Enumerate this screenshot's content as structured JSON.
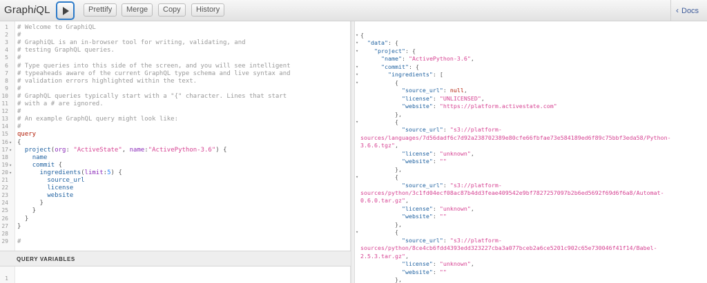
{
  "toolbar": {
    "title_prefix": "Graph",
    "title_em": "i",
    "title_suffix": "QL",
    "buttons": [
      "Prettify",
      "Merge",
      "Copy",
      "History"
    ],
    "docs_label": "Docs"
  },
  "editor": {
    "lines": [
      {
        "n": "1",
        "fold": "",
        "parts": [
          [
            "c-comment",
            "# Welcome to GraphiQL"
          ]
        ]
      },
      {
        "n": "2",
        "fold": "",
        "parts": [
          [
            "c-comment",
            "#"
          ]
        ]
      },
      {
        "n": "3",
        "fold": "",
        "parts": [
          [
            "c-comment",
            "# GraphiQL is an in-browser tool for writing, validating, and"
          ]
        ]
      },
      {
        "n": "4",
        "fold": "",
        "parts": [
          [
            "c-comment",
            "# testing GraphQL queries."
          ]
        ]
      },
      {
        "n": "5",
        "fold": "",
        "parts": [
          [
            "c-comment",
            "#"
          ]
        ]
      },
      {
        "n": "6",
        "fold": "",
        "parts": [
          [
            "c-comment",
            "# Type queries into this side of the screen, and you will see intelligent"
          ]
        ]
      },
      {
        "n": "7",
        "fold": "",
        "parts": [
          [
            "c-comment",
            "# typeaheads aware of the current GraphQL type schema and live syntax and"
          ]
        ]
      },
      {
        "n": "8",
        "fold": "",
        "parts": [
          [
            "c-comment",
            "# validation errors highlighted within the text."
          ]
        ]
      },
      {
        "n": "9",
        "fold": "",
        "parts": [
          [
            "c-comment",
            "#"
          ]
        ]
      },
      {
        "n": "10",
        "fold": "",
        "parts": [
          [
            "c-comment",
            "# GraphQL queries typically start with a \"{\" character. Lines that start"
          ]
        ]
      },
      {
        "n": "11",
        "fold": "",
        "parts": [
          [
            "c-comment",
            "# with a # are ignored."
          ]
        ]
      },
      {
        "n": "12",
        "fold": "",
        "parts": [
          [
            "c-comment",
            "#"
          ]
        ]
      },
      {
        "n": "13",
        "fold": "",
        "parts": [
          [
            "c-comment",
            "# An example GraphQL query might look like:"
          ]
        ]
      },
      {
        "n": "14",
        "fold": "",
        "parts": [
          [
            "c-comment",
            "#"
          ]
        ]
      },
      {
        "n": "15",
        "fold": "",
        "parts": [
          [
            "c-kw",
            "query"
          ]
        ]
      },
      {
        "n": "16",
        "fold": "▾",
        "parts": [
          [
            "c-punct",
            "{"
          ]
        ]
      },
      {
        "n": "17",
        "fold": "▾",
        "parts": [
          [
            "c-punct",
            "  "
          ],
          [
            "c-prop",
            "project"
          ],
          [
            "c-punct",
            "("
          ],
          [
            "c-attr",
            "org"
          ],
          [
            "c-punct",
            ": "
          ],
          [
            "c-str",
            "\"ActiveState\""
          ],
          [
            "c-punct",
            ", "
          ],
          [
            "c-attr",
            "name"
          ],
          [
            "c-punct",
            ":"
          ],
          [
            "c-str",
            "\"ActivePython-3.6\""
          ],
          [
            "c-punct",
            ") {"
          ]
        ]
      },
      {
        "n": "18",
        "fold": "",
        "parts": [
          [
            "c-punct",
            "    "
          ],
          [
            "c-prop",
            "name"
          ]
        ]
      },
      {
        "n": "19",
        "fold": "▾",
        "parts": [
          [
            "c-punct",
            "    "
          ],
          [
            "c-prop",
            "commit"
          ],
          [
            "c-punct",
            " {"
          ]
        ]
      },
      {
        "n": "20",
        "fold": "▾",
        "parts": [
          [
            "c-punct",
            "      "
          ],
          [
            "c-prop",
            "ingredients"
          ],
          [
            "c-punct",
            "("
          ],
          [
            "c-attr",
            "limit"
          ],
          [
            "c-punct",
            ":"
          ],
          [
            "c-num",
            "5"
          ],
          [
            "c-punct",
            ") {"
          ]
        ]
      },
      {
        "n": "21",
        "fold": "",
        "parts": [
          [
            "c-punct",
            "        "
          ],
          [
            "c-prop",
            "source_url"
          ]
        ]
      },
      {
        "n": "22",
        "fold": "",
        "parts": [
          [
            "c-punct",
            "        "
          ],
          [
            "c-prop",
            "license"
          ]
        ]
      },
      {
        "n": "23",
        "fold": "",
        "parts": [
          [
            "c-punct",
            "        "
          ],
          [
            "c-prop",
            "website"
          ]
        ]
      },
      {
        "n": "24",
        "fold": "",
        "parts": [
          [
            "c-punct",
            "      }"
          ]
        ]
      },
      {
        "n": "25",
        "fold": "",
        "parts": [
          [
            "c-punct",
            "    }"
          ]
        ]
      },
      {
        "n": "26",
        "fold": "",
        "parts": [
          [
            "c-punct",
            "  }"
          ]
        ]
      },
      {
        "n": "27",
        "fold": "",
        "parts": [
          [
            "c-punct",
            "}"
          ]
        ]
      },
      {
        "n": "28",
        "fold": "",
        "parts": [
          [
            "c-punct",
            ""
          ]
        ]
      },
      {
        "n": "29",
        "fold": "",
        "parts": [
          [
            "c-comment",
            "#"
          ]
        ]
      }
    ]
  },
  "query_variables": {
    "title": "QUERY VARIABLES",
    "line_number": "1"
  },
  "result": {
    "lines": [
      {
        "fold": "▾",
        "parts": [
          [
            "p",
            "{"
          ]
        ]
      },
      {
        "fold": "▾",
        "parts": [
          [
            "p",
            "  "
          ],
          [
            "k",
            "\"data\""
          ],
          [
            "p",
            ": {"
          ]
        ]
      },
      {
        "fold": "▾",
        "parts": [
          [
            "p",
            "    "
          ],
          [
            "k",
            "\"project\""
          ],
          [
            "p",
            ": {"
          ]
        ]
      },
      {
        "fold": "",
        "parts": [
          [
            "p",
            "      "
          ],
          [
            "k",
            "\"name\""
          ],
          [
            "p",
            ": "
          ],
          [
            "s",
            "\"ActivePython-3.6\""
          ],
          [
            "p",
            ","
          ]
        ]
      },
      {
        "fold": "▾",
        "parts": [
          [
            "p",
            "      "
          ],
          [
            "k",
            "\"commit\""
          ],
          [
            "p",
            ": {"
          ]
        ]
      },
      {
        "fold": "▾",
        "parts": [
          [
            "p",
            "        "
          ],
          [
            "k",
            "\"ingredients\""
          ],
          [
            "p",
            ": ["
          ]
        ]
      },
      {
        "fold": "▾",
        "parts": [
          [
            "p",
            "          {"
          ]
        ]
      },
      {
        "fold": "",
        "parts": [
          [
            "p",
            "            "
          ],
          [
            "k",
            "\"source_url\""
          ],
          [
            "p",
            ": "
          ],
          [
            "n",
            "null"
          ],
          [
            "p",
            ","
          ]
        ]
      },
      {
        "fold": "",
        "parts": [
          [
            "p",
            "            "
          ],
          [
            "k",
            "\"license\""
          ],
          [
            "p",
            ": "
          ],
          [
            "s",
            "\"UNLICENSED\""
          ],
          [
            "p",
            ","
          ]
        ]
      },
      {
        "fold": "",
        "parts": [
          [
            "p",
            "            "
          ],
          [
            "k",
            "\"website\""
          ],
          [
            "p",
            ": "
          ],
          [
            "s",
            "\"https://platform.activestate.com\""
          ]
        ]
      },
      {
        "fold": "",
        "parts": [
          [
            "p",
            "          },"
          ]
        ]
      },
      {
        "fold": "▾",
        "parts": [
          [
            "p",
            "          {"
          ]
        ]
      },
      {
        "fold": "",
        "parts": [
          [
            "p",
            "            "
          ],
          [
            "k",
            "\"source_url\""
          ],
          [
            "p",
            ": "
          ],
          [
            "s",
            "\"s3://platform-"
          ]
        ]
      },
      {
        "fold": "",
        "parts": [
          [
            "s",
            "sources/languages/7d56dadf6c7d92a238702389e80cfe66fbfae73e584189ed6f89c75bbf3eda58/Python-"
          ]
        ]
      },
      {
        "fold": "",
        "parts": [
          [
            "s",
            "3.6.6.tgz\""
          ],
          [
            "p",
            ","
          ]
        ]
      },
      {
        "fold": "",
        "parts": [
          [
            "p",
            "            "
          ],
          [
            "k",
            "\"license\""
          ],
          [
            "p",
            ": "
          ],
          [
            "s",
            "\"unknown\""
          ],
          [
            "p",
            ","
          ]
        ]
      },
      {
        "fold": "",
        "parts": [
          [
            "p",
            "            "
          ],
          [
            "k",
            "\"website\""
          ],
          [
            "p",
            ": "
          ],
          [
            "s",
            "\"\""
          ]
        ]
      },
      {
        "fold": "",
        "parts": [
          [
            "p",
            "          },"
          ]
        ]
      },
      {
        "fold": "▾",
        "parts": [
          [
            "p",
            "          {"
          ]
        ]
      },
      {
        "fold": "",
        "parts": [
          [
            "p",
            "            "
          ],
          [
            "k",
            "\"source_url\""
          ],
          [
            "p",
            ": "
          ],
          [
            "s",
            "\"s3://platform-"
          ]
        ]
      },
      {
        "fold": "",
        "parts": [
          [
            "s",
            "sources/python/3c1fd04ecf08ac87b4dd3feae409542e9bf7827257097b2b6ed5692f69d6f6a8/Automat-"
          ]
        ]
      },
      {
        "fold": "",
        "parts": [
          [
            "s",
            "0.6.0.tar.gz\""
          ],
          [
            "p",
            ","
          ]
        ]
      },
      {
        "fold": "",
        "parts": [
          [
            "p",
            "            "
          ],
          [
            "k",
            "\"license\""
          ],
          [
            "p",
            ": "
          ],
          [
            "s",
            "\"unknown\""
          ],
          [
            "p",
            ","
          ]
        ]
      },
      {
        "fold": "",
        "parts": [
          [
            "p",
            "            "
          ],
          [
            "k",
            "\"website\""
          ],
          [
            "p",
            ": "
          ],
          [
            "s",
            "\"\""
          ]
        ]
      },
      {
        "fold": "",
        "parts": [
          [
            "p",
            "          },"
          ]
        ]
      },
      {
        "fold": "▾",
        "parts": [
          [
            "p",
            "          {"
          ]
        ]
      },
      {
        "fold": "",
        "parts": [
          [
            "p",
            "            "
          ],
          [
            "k",
            "\"source_url\""
          ],
          [
            "p",
            ": "
          ],
          [
            "s",
            "\"s3://platform-"
          ]
        ]
      },
      {
        "fold": "",
        "parts": [
          [
            "s",
            "sources/python/8ce4cb6fdd4393edd323227cba3a077bceb2a6ce5201c902c65e730046f41f14/Babel-"
          ]
        ]
      },
      {
        "fold": "",
        "parts": [
          [
            "s",
            "2.5.3.tar.gz\""
          ],
          [
            "p",
            ","
          ]
        ]
      },
      {
        "fold": "",
        "parts": [
          [
            "p",
            "            "
          ],
          [
            "k",
            "\"license\""
          ],
          [
            "p",
            ": "
          ],
          [
            "s",
            "\"unknown\""
          ],
          [
            "p",
            ","
          ]
        ]
      },
      {
        "fold": "",
        "parts": [
          [
            "p",
            "            "
          ],
          [
            "k",
            "\"website\""
          ],
          [
            "p",
            ": "
          ],
          [
            "s",
            "\"\""
          ]
        ]
      },
      {
        "fold": "",
        "parts": [
          [
            "p",
            "          },"
          ]
        ]
      }
    ]
  }
}
